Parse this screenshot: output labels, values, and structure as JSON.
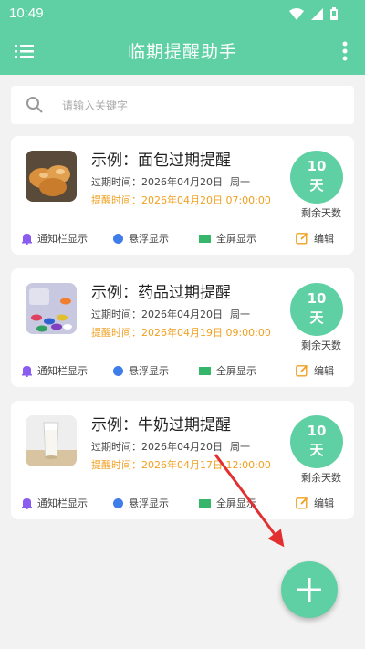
{
  "status": {
    "time": "10:49"
  },
  "app": {
    "title": "临期提醒助手"
  },
  "search": {
    "placeholder": "请输入关键字"
  },
  "cards": [
    {
      "title": "示例：面包过期提醒",
      "expire_label": "过期时间：2026年04月20日",
      "expire_weekday": "周一",
      "remind_label": "提醒时间：2026年04月20日 07:00:00",
      "days_num": "10",
      "days_unit": "天",
      "days_label": "剩余天数",
      "thumb": "bread-thumbnail",
      "actions": {
        "notify": "通知栏显示",
        "float": "悬浮显示",
        "fullscreen": "全屏显示",
        "edit": "编辑"
      }
    },
    {
      "title": "示例：药品过期提醒",
      "expire_label": "过期时间：2026年04月20日",
      "expire_weekday": "周一",
      "remind_label": "提醒时间：2026年04月19日 09:00:00",
      "days_num": "10",
      "days_unit": "天",
      "days_label": "剩余天数",
      "thumb": "medicine-thumbnail",
      "actions": {
        "notify": "通知栏显示",
        "float": "悬浮显示",
        "fullscreen": "全屏显示",
        "edit": "编辑"
      }
    },
    {
      "title": "示例：牛奶过期提醒",
      "expire_label": "过期时间：2026年04月20日",
      "expire_weekday": "周一",
      "remind_label": "提醒时间：2026年04月17日 12:00:00",
      "days_num": "10",
      "days_unit": "天",
      "days_label": "剩余天数",
      "thumb": "milk-thumbnail",
      "actions": {
        "notify": "通知栏显示",
        "float": "悬浮显示",
        "fullscreen": "全屏显示",
        "edit": "编辑"
      }
    }
  ],
  "colors": {
    "accent": "#5fd0a4",
    "remind": "#f0a020",
    "annotation_arrow": "#e23030"
  }
}
